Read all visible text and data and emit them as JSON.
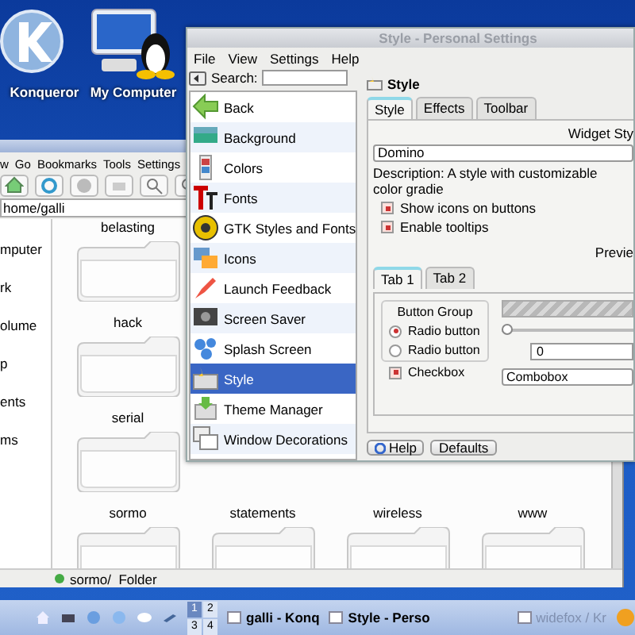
{
  "desktop_icons": [
    {
      "label": "Konqueror"
    },
    {
      "label": "My Computer"
    }
  ],
  "file_manager": {
    "menu": [
      "w",
      "Go",
      "Bookmarks",
      "Tools",
      "Settings"
    ],
    "location": "home/galli",
    "sidebar": [
      "mputer",
      "rk",
      "olume",
      "p",
      "ents",
      "ms"
    ],
    "folders": [
      "belasting",
      "hack",
      "serial",
      "sormo",
      "statements",
      "wireless",
      "www"
    ],
    "status": "sormo/  Folder"
  },
  "settings_window": {
    "title": "Style - Personal Settings",
    "menu": [
      "File",
      "View",
      "Settings",
      "Help"
    ],
    "search_label": "Search:",
    "modules": [
      {
        "label": "Back",
        "selected": false
      },
      {
        "label": "Background",
        "selected": false
      },
      {
        "label": "Colors",
        "selected": false
      },
      {
        "label": "Fonts",
        "selected": false
      },
      {
        "label": "GTK Styles and Fonts",
        "selected": false
      },
      {
        "label": "Icons",
        "selected": false
      },
      {
        "label": "Launch Feedback",
        "selected": false
      },
      {
        "label": "Screen Saver",
        "selected": false
      },
      {
        "label": "Splash Screen",
        "selected": false
      },
      {
        "label": "Style",
        "selected": true
      },
      {
        "label": "Theme Manager",
        "selected": false
      },
      {
        "label": "Window Decorations",
        "selected": false
      }
    ],
    "page_title": "Style",
    "tabs": [
      {
        "label": "Style",
        "selected": true
      },
      {
        "label": "Effects",
        "selected": false
      },
      {
        "label": "Toolbar",
        "selected": false
      }
    ],
    "widget_style_label": "Widget Sty",
    "widget_style": "Domino",
    "description": "Description: A style with customizable color gradie",
    "options": [
      {
        "label": "Show icons on buttons",
        "checked": true
      },
      {
        "label": "Enable tooltips",
        "checked": true
      }
    ],
    "preview": {
      "label": "Previe",
      "tabs": [
        {
          "label": "Tab 1",
          "selected": true
        },
        {
          "label": "Tab 2",
          "selected": false
        }
      ],
      "group_title": "Button Group",
      "radios": [
        {
          "label": "Radio button",
          "selected": true
        },
        {
          "label": "Radio button",
          "selected": false
        }
      ],
      "checkbox": {
        "label": "Checkbox",
        "checked": true
      },
      "progress": {
        "level": 1
      },
      "slider": {
        "level": 0
      },
      "spin_value": "0",
      "combo": "Combobox"
    },
    "buttons": [
      {
        "kind": "help",
        "label": "Help"
      },
      {
        "kind": "plain",
        "label": "Defaults"
      }
    ]
  },
  "taskbar": {
    "pager": [
      "1",
      "2",
      "3",
      "4"
    ],
    "tasks": [
      {
        "label": "galli - Konq",
        "disabled": false
      },
      {
        "label": "Style - Perso",
        "disabled": false
      },
      {
        "label": "widefox / Kr",
        "disabled": true
      }
    ]
  }
}
